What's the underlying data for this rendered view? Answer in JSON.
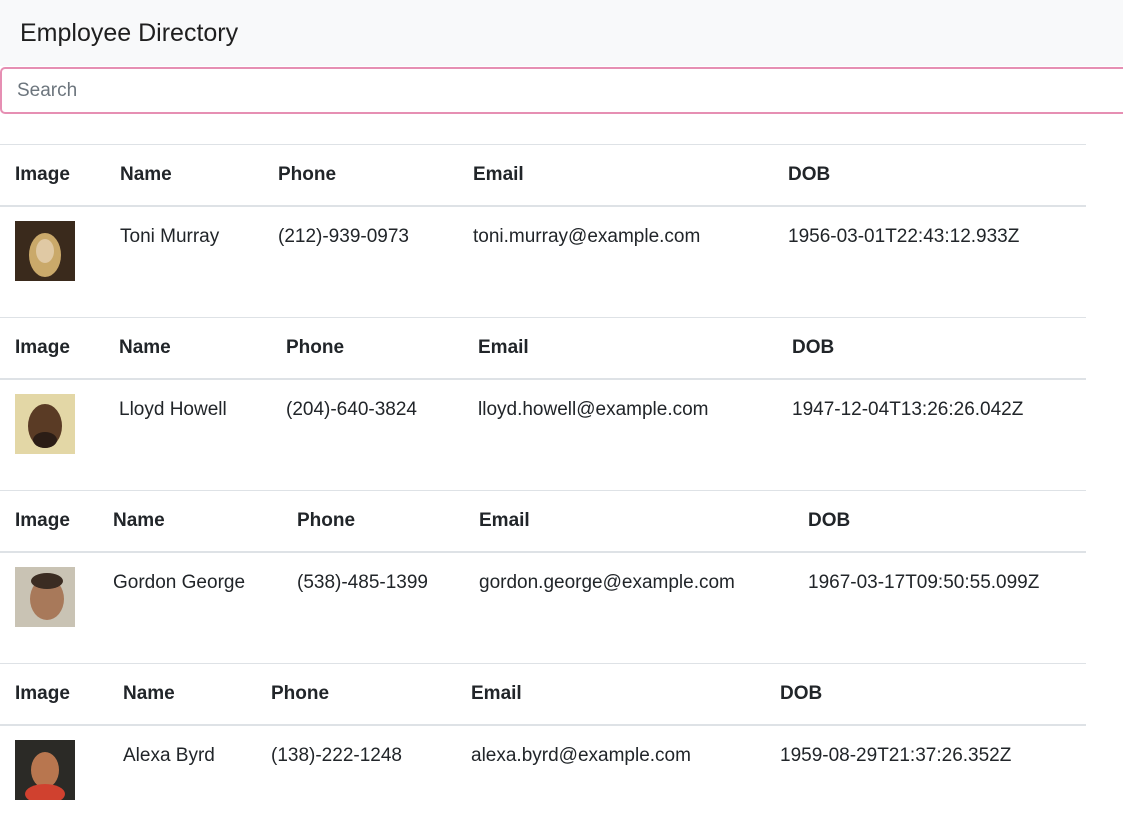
{
  "header": {
    "title": "Employee Directory"
  },
  "search": {
    "placeholder": "Search"
  },
  "columns": [
    "Image",
    "Name",
    "Phone",
    "Email",
    "DOB"
  ],
  "employees": [
    {
      "name": "Toni Murray",
      "phone": "(212)-939-0973",
      "email": "toni.murray@example.com",
      "dob": "1956-03-01T22:43:12.933Z",
      "avatar_colors": [
        "#3a2a1c",
        "#caa96a",
        "#e0c9a4"
      ]
    },
    {
      "name": "Lloyd Howell",
      "phone": "(204)-640-3824",
      "email": "lloyd.howell@example.com",
      "dob": "1947-12-04T13:26:26.042Z",
      "avatar_colors": [
        "#e3d7a6",
        "#5a3b25",
        "#2b1d16"
      ]
    },
    {
      "name": "Gordon George",
      "phone": "(538)-485-1399",
      "email": "gordon.george@example.com",
      "dob": "1967-03-17T09:50:55.099Z",
      "avatar_colors": [
        "#c9c3b4",
        "#a8795a",
        "#3b2c22"
      ]
    },
    {
      "name": "Alexa Byrd",
      "phone": "(138)-222-1248",
      "email": "alexa.byrd@example.com",
      "dob": "1959-08-29T21:37:26.352Z",
      "avatar_colors": [
        "#2b2a26",
        "#b8764f",
        "#d0412f"
      ]
    }
  ]
}
